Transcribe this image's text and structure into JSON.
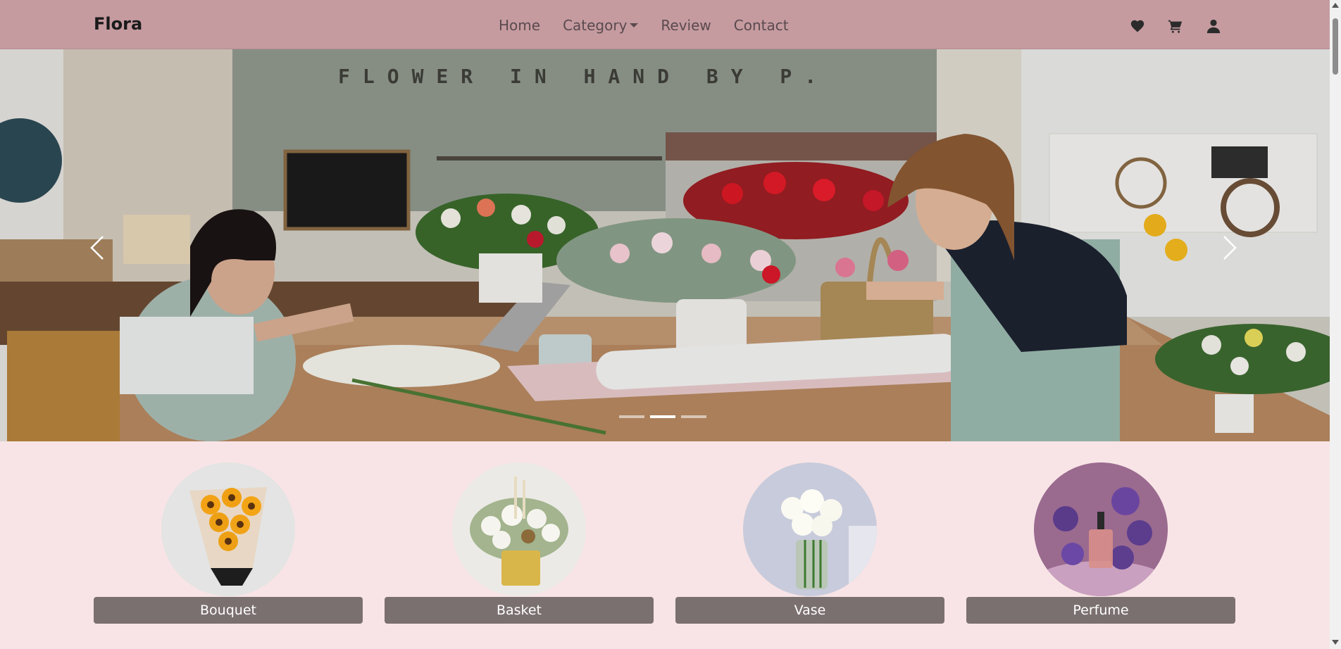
{
  "navbar": {
    "brand": "Flora",
    "links": [
      {
        "label": "Home"
      },
      {
        "label": "Category",
        "has_dropdown": true
      },
      {
        "label": "Review"
      },
      {
        "label": "Contact"
      }
    ],
    "icons": [
      "heart-icon",
      "cart-icon",
      "user-icon"
    ]
  },
  "hero": {
    "sign_text": "FLOWER IN HAND BY P.",
    "slide_count": 3,
    "active_slide": 2,
    "prev_icon": "chevron-left-icon",
    "next_icon": "chevron-right-icon"
  },
  "categories": [
    {
      "label": "Bouquet",
      "image": "sunflower-bouquet"
    },
    {
      "label": "Basket",
      "image": "white-flower-basket"
    },
    {
      "label": "Vase",
      "image": "white-roses-vase"
    },
    {
      "label": "Perfume",
      "image": "perfume-with-purple-flowers"
    }
  ],
  "colors": {
    "navbar_bg": "#c59ba0",
    "page_bg": "#f8e4e6",
    "category_button_bg": "#7b7070"
  }
}
